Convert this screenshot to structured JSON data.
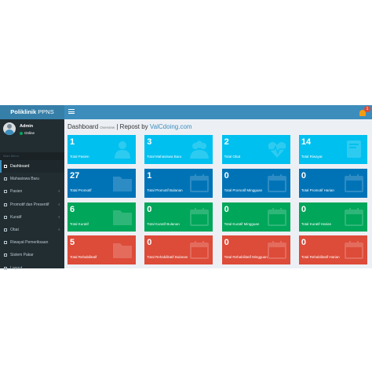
{
  "brand": {
    "bold": "Poliklinik",
    "rest": " PPNS"
  },
  "header": {
    "notification_count": "1"
  },
  "user": {
    "name": "Admin",
    "status": "Online"
  },
  "sidebar": {
    "header": "Main Menu",
    "items": [
      {
        "label": "Dashboard",
        "active": true,
        "caret": ""
      },
      {
        "label": "Mahasiswa Baru",
        "caret": ""
      },
      {
        "label": "Pasien",
        "caret": "‹"
      },
      {
        "label": "Promotif dan Presentif",
        "caret": "‹"
      },
      {
        "label": "Kuratif",
        "caret": "‹"
      },
      {
        "label": "Obat",
        "caret": "‹"
      },
      {
        "label": "Riwayat Pemeriksaan",
        "caret": ""
      },
      {
        "label": "Sistem Pakar",
        "caret": ""
      },
      {
        "label": "Logout",
        "caret": ""
      }
    ]
  },
  "page": {
    "title": "Dashboard",
    "subtitle": "Overview",
    "separator": " | Repost by ",
    "link": "ValCdoing.com"
  },
  "boxes": [
    {
      "value": "1",
      "label": "Total Pasien",
      "color": "#00c0ef",
      "icon": "user-icon"
    },
    {
      "value": "3",
      "label": "Total Mahasiswa Baru",
      "color": "#00c0ef",
      "icon": "users-icon"
    },
    {
      "value": "2",
      "label": "Total Obat",
      "color": "#00c0ef",
      "icon": "heartbeat-icon"
    },
    {
      "value": "14",
      "label": "Total Riwayat",
      "color": "#00c0ef",
      "icon": "book-icon"
    },
    {
      "value": "27",
      "label": "Total Promotif",
      "color": "#0073b7",
      "icon": "folder-icon"
    },
    {
      "value": "1",
      "label": "Total Promotif Bulanan",
      "color": "#0073b7",
      "icon": "calendar-icon"
    },
    {
      "value": "0",
      "label": "Total Promotif Mingguan",
      "color": "#0073b7",
      "icon": "calendar-icon"
    },
    {
      "value": "0",
      "label": "Total Promotif Harian",
      "color": "#0073b7",
      "icon": "calendar-icon"
    },
    {
      "value": "6",
      "label": "Total Kuratif",
      "color": "#00a65a",
      "icon": "folder-icon"
    },
    {
      "value": "0",
      "label": "Total Kuratif Bulanan",
      "color": "#00a65a",
      "icon": "calendar-icon"
    },
    {
      "value": "0",
      "label": "Total Kuratif Mingguan",
      "color": "#00a65a",
      "icon": "calendar-icon"
    },
    {
      "value": "0",
      "label": "Total Kuratif Harian",
      "color": "#00a65a",
      "icon": "calendar-icon"
    },
    {
      "value": "5",
      "label": "Total Rehabilitatif",
      "color": "#dd4b39",
      "icon": "folder-icon"
    },
    {
      "value": "0",
      "label": "Total Rehabilitatif Bulanan",
      "color": "#dd4b39",
      "icon": "calendar-icon"
    },
    {
      "value": "0",
      "label": "Total Rehabilitatif Mingguan",
      "color": "#dd4b39",
      "icon": "calendar-icon"
    },
    {
      "value": "0",
      "label": "Total Rehabilitatif Harian",
      "color": "#dd4b39",
      "icon": "calendar-icon"
    }
  ]
}
